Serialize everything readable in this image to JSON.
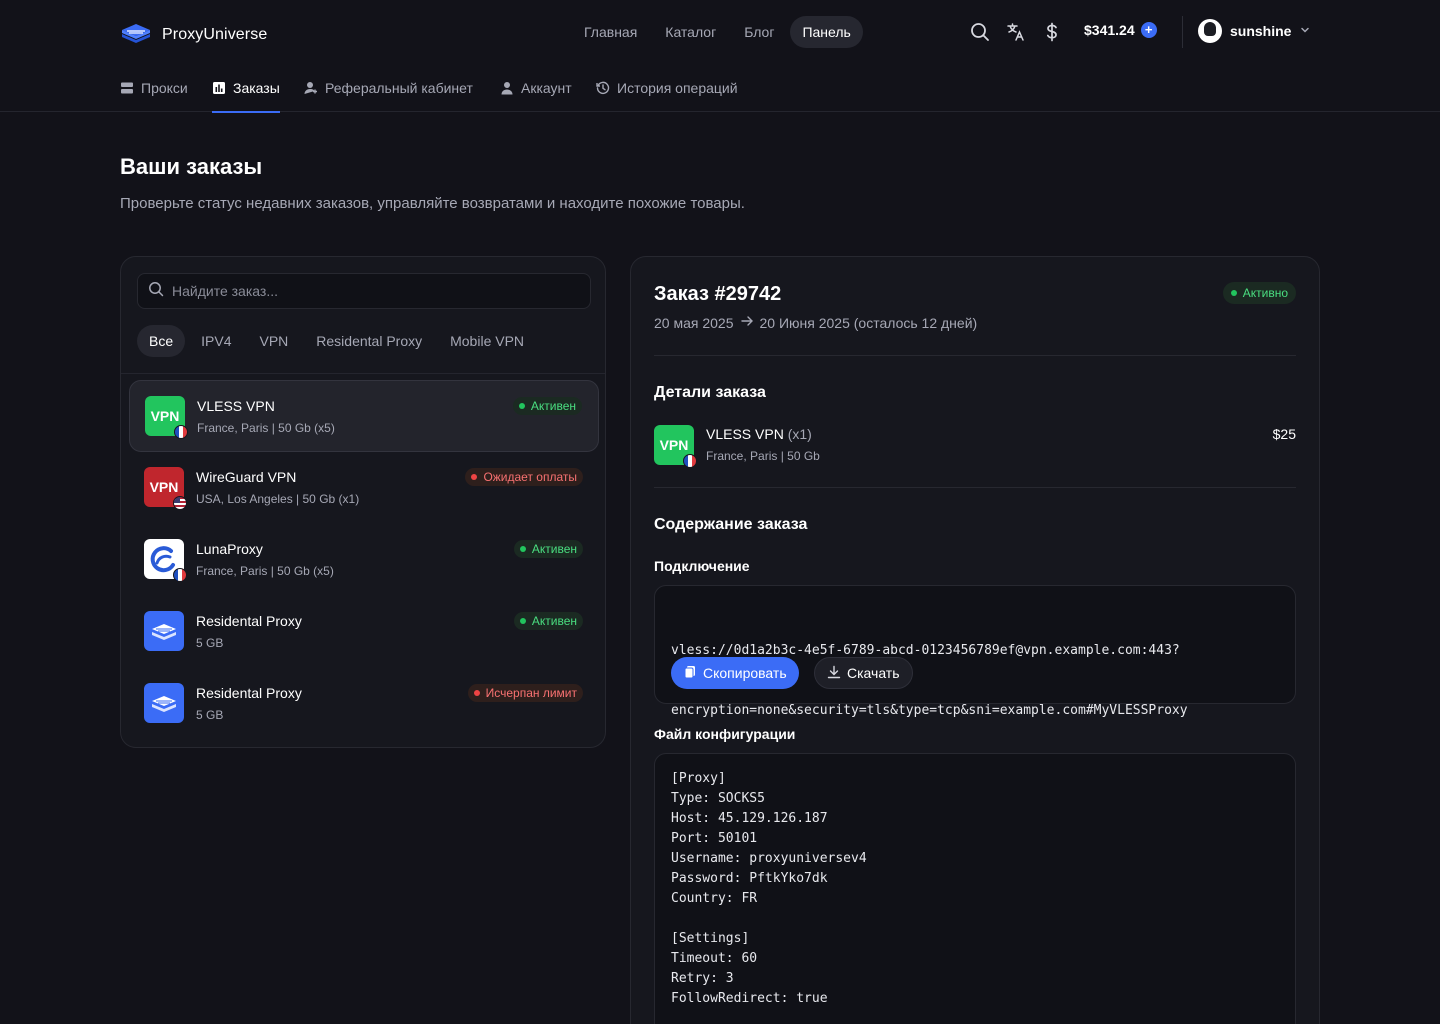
{
  "brand": {
    "name": "ProxyUniverse"
  },
  "nav": {
    "items": [
      "Главная",
      "Каталог",
      "Блог",
      "Панель"
    ],
    "active": "Панель"
  },
  "header": {
    "balance": "$341.24",
    "username": "sunshine"
  },
  "subnav": {
    "tabs": [
      "Прокси",
      "Заказы",
      "Реферальный кабинет",
      "Аккаунт",
      "История операций"
    ],
    "active": "Заказы"
  },
  "page": {
    "title": "Ваши заказы",
    "subtitle": "Проверьте статус недавних заказов, управляйте возвратами и находите похожие товары."
  },
  "orders_panel": {
    "search_placeholder": "Найдите заказ...",
    "filters": [
      "Все",
      "IPV4",
      "VPN",
      "Residental Proxy",
      "Mobile VPN"
    ],
    "active_filter": "Все",
    "items": [
      {
        "name": "VLESS VPN",
        "meta": "France, Paris | 50 Gb (x5)",
        "status": "Активен",
        "icon": "vpn-green-icon",
        "flag": "france-flag-icon"
      },
      {
        "name": "WireGuard VPN",
        "meta": "USA, Los Angeles | 50 Gb (x1)",
        "status": "Ожидает оплаты",
        "icon": "vpn-red-icon",
        "flag": "usa-flag-icon"
      },
      {
        "name": "LunaProxy",
        "meta": "France, Paris | 50 Gb (x5)",
        "status": "Активен",
        "icon": "lunaproxy-logo-icon",
        "flag": "france-flag-icon"
      },
      {
        "name": "Residental Proxy",
        "meta": "5 GB",
        "status": "Активен",
        "icon": "proxyuniverse-logo-icon"
      },
      {
        "name": "Residental Proxy",
        "meta": "5 GB",
        "status": "Исчерпан лимит",
        "icon": "proxyuniverse-logo-icon"
      }
    ]
  },
  "order_detail": {
    "title": "Заказ #29742",
    "status": "Активно",
    "date_from": "20 мая 2025",
    "date_to": "20 Июня 2025 (осталось 12 дней)",
    "details_heading": "Детали заказа",
    "product": {
      "name": "VLESS VPN",
      "qty": "(x1)",
      "meta": "France, Paris | 50 Gb",
      "price": "$25",
      "icon_text": "VPN"
    },
    "content_heading": "Содержание заказа",
    "connection_label": "Подключение",
    "connection_line1": "vless://0d1a2b3c-4e5f-6789-abcd-0123456789ef@vpn.example.com:443?",
    "connection_line2": "encryption=none&security=tls&type=tcp&sni=example.com#MyVLESSProxy",
    "copy_label": "Скопировать",
    "download_label": "Скачать",
    "config_label": "Файл конфигурации",
    "config_text": "[Proxy]\nType: SOCKS5\nHost: 45.129.126.187\nPort: 50101\nUsername: proxyuniversev4\nPassword: PftkYko7dk\nCountry: FR\n\n[Settings]\nTimeout: 60\nRetry: 3\nFollowRedirect: true"
  },
  "tile_text": "VPN",
  "colors": {
    "background": "#121219",
    "accent": "#3b6cf6",
    "active_green": "#4ade80",
    "warning_red": "#f87171",
    "vpn_green": "#22c55e",
    "vpn_red": "#c0262d"
  }
}
